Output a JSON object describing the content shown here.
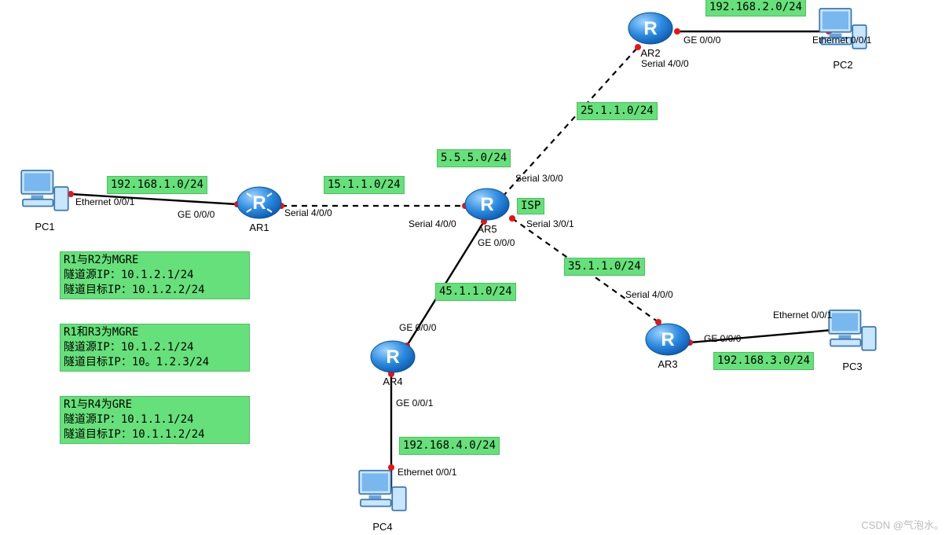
{
  "devices": {
    "pc1": {
      "label": "PC1"
    },
    "pc2": {
      "label": "PC2"
    },
    "pc3": {
      "label": "PC3"
    },
    "pc4": {
      "label": "PC4"
    },
    "ar1": {
      "label": "AR1"
    },
    "ar2": {
      "label": "AR2"
    },
    "ar3": {
      "label": "AR3"
    },
    "ar4": {
      "label": "AR4"
    },
    "ar5": {
      "label": "AR5"
    }
  },
  "portlabels": {
    "pc1_eth": "Ethernet 0/0/1",
    "pc2_eth": "Ethernet 0/0/1",
    "pc3_eth": "Ethernet 0/0/1",
    "pc4_eth": "Ethernet 0/0/1",
    "ar1_ge": "GE 0/0/0",
    "ar1_ser": "Serial 4/0/0",
    "ar2_ge": "GE 0/0/0",
    "ar2_ser": "Serial 4/0/0",
    "ar3_ge": "GE 0/0/0",
    "ar3_ser": "Serial 4/0/0",
    "ar4_ge0": "GE 0/0/0",
    "ar4_ge1": "GE 0/0/1",
    "ar5_s40": "Serial 4/0/0",
    "ar5_s30": "Serial 3/0/0",
    "ar5_s31": "Serial 3/0/1",
    "ar5_ge": "GE 0/0/0",
    "isp": "ISP"
  },
  "subnets": {
    "pc1net": "192.168.1.0/24",
    "pc2net": "192.168.2.0/24",
    "pc3net": "192.168.3.0/24",
    "pc4net": "192.168.4.0/24",
    "ar1ar5": "15.1.1.0/24",
    "ar2ar5": "25.1.1.0/24",
    "ar3ar5": "35.1.1.0/24",
    "ar4ar5": "45.1.1.0/24",
    "ar5lo": "5.5.5.0/24"
  },
  "notes": {
    "n1_l1": "R1与R2为MGRE",
    "n1_l2": "隧道源IP：10.1.2.1/24",
    "n1_l3": "隧道目标IP：10.1.2.2/24",
    "n2_l1": "R1和R3为MGRE",
    "n2_l2": "隧道源IP：10.1.2.1/24",
    "n2_l3": "隧道目标IP：10。1.2.3/24",
    "n3_l1": "R1与R4为GRE",
    "n3_l2": "隧道源IP：10.1.1.1/24",
    "n3_l3": "隧道目标IP：10.1.1.2/24"
  },
  "watermark": "CSDN @气泡水。"
}
